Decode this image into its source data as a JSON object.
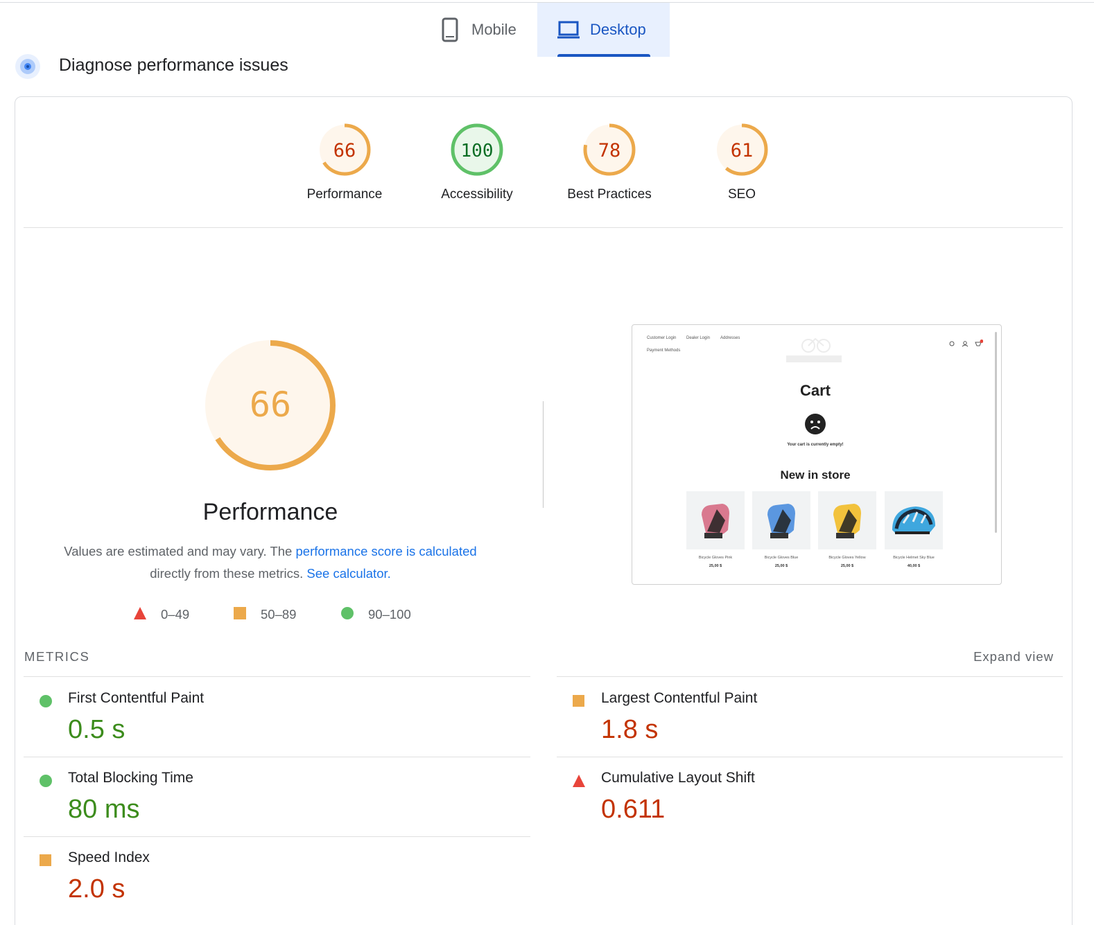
{
  "tabs": {
    "mobile_label": "Mobile",
    "desktop_label": "Desktop",
    "active": "Desktop"
  },
  "diagnose_title": "Diagnose performance issues",
  "scores": [
    {
      "label": "Performance",
      "value": "66",
      "score": 66,
      "rating": "average"
    },
    {
      "label": "Accessibility",
      "value": "100",
      "score": 100,
      "rating": "pass"
    },
    {
      "label": "Best Practices",
      "value": "78",
      "score": 78,
      "rating": "average"
    },
    {
      "label": "SEO",
      "value": "61",
      "score": 61,
      "rating": "average"
    }
  ],
  "main_gauge": {
    "value": "66",
    "score": 66,
    "title": "Performance"
  },
  "description": {
    "text1": "Values are estimated and may vary. The ",
    "link1": "performance score is calculated",
    "text2": "directly from these metrics. ",
    "link2": "See calculator."
  },
  "legend": [
    {
      "range": "0–49",
      "shape": "triangle",
      "color": "#e8443a"
    },
    {
      "range": "50–89",
      "shape": "square",
      "color": "#eca94b"
    },
    {
      "range": "90–100",
      "shape": "circle",
      "color": "#5fc168"
    }
  ],
  "metrics_label": "METRICS",
  "expand_label": "Expand view",
  "metrics": [
    {
      "name": "First Contentful Paint",
      "value": "0.5 s",
      "rating": "pass"
    },
    {
      "name": "Largest Contentful Paint",
      "value": "1.8 s",
      "rating": "average"
    },
    {
      "name": "Total Blocking Time",
      "value": "80 ms",
      "rating": "pass"
    },
    {
      "name": "Cumulative Layout Shift",
      "value": "0.611",
      "rating": "fail"
    },
    {
      "name": "Speed Index",
      "value": "2.0 s",
      "rating": "average"
    }
  ],
  "screenshot": {
    "nav": [
      "Customer Login",
      "Dealer Login",
      "Addresses",
      "Payment Methods"
    ],
    "cart_title": "Cart",
    "empty_message": "Your cart is currently empty!",
    "new_title": "New in store",
    "products": [
      {
        "name": "Bicycle Gloves Pink",
        "price": "25,00 $",
        "color": "#d9798f"
      },
      {
        "name": "Bicycle Gloves Blue",
        "price": "25,00 $",
        "color": "#5b97e0"
      },
      {
        "name": "Bicycle Gloves Yellow",
        "price": "25,00 $",
        "color": "#f2c23c"
      },
      {
        "name": "Bicycle Helmet Sky Blue",
        "price": "40,00 $",
        "color": "#3fa7de"
      }
    ]
  },
  "colors": {
    "pass": "#0c8a2a",
    "average": "#eca94b",
    "fail": "#e8443a",
    "accent": "#1a56c2"
  }
}
